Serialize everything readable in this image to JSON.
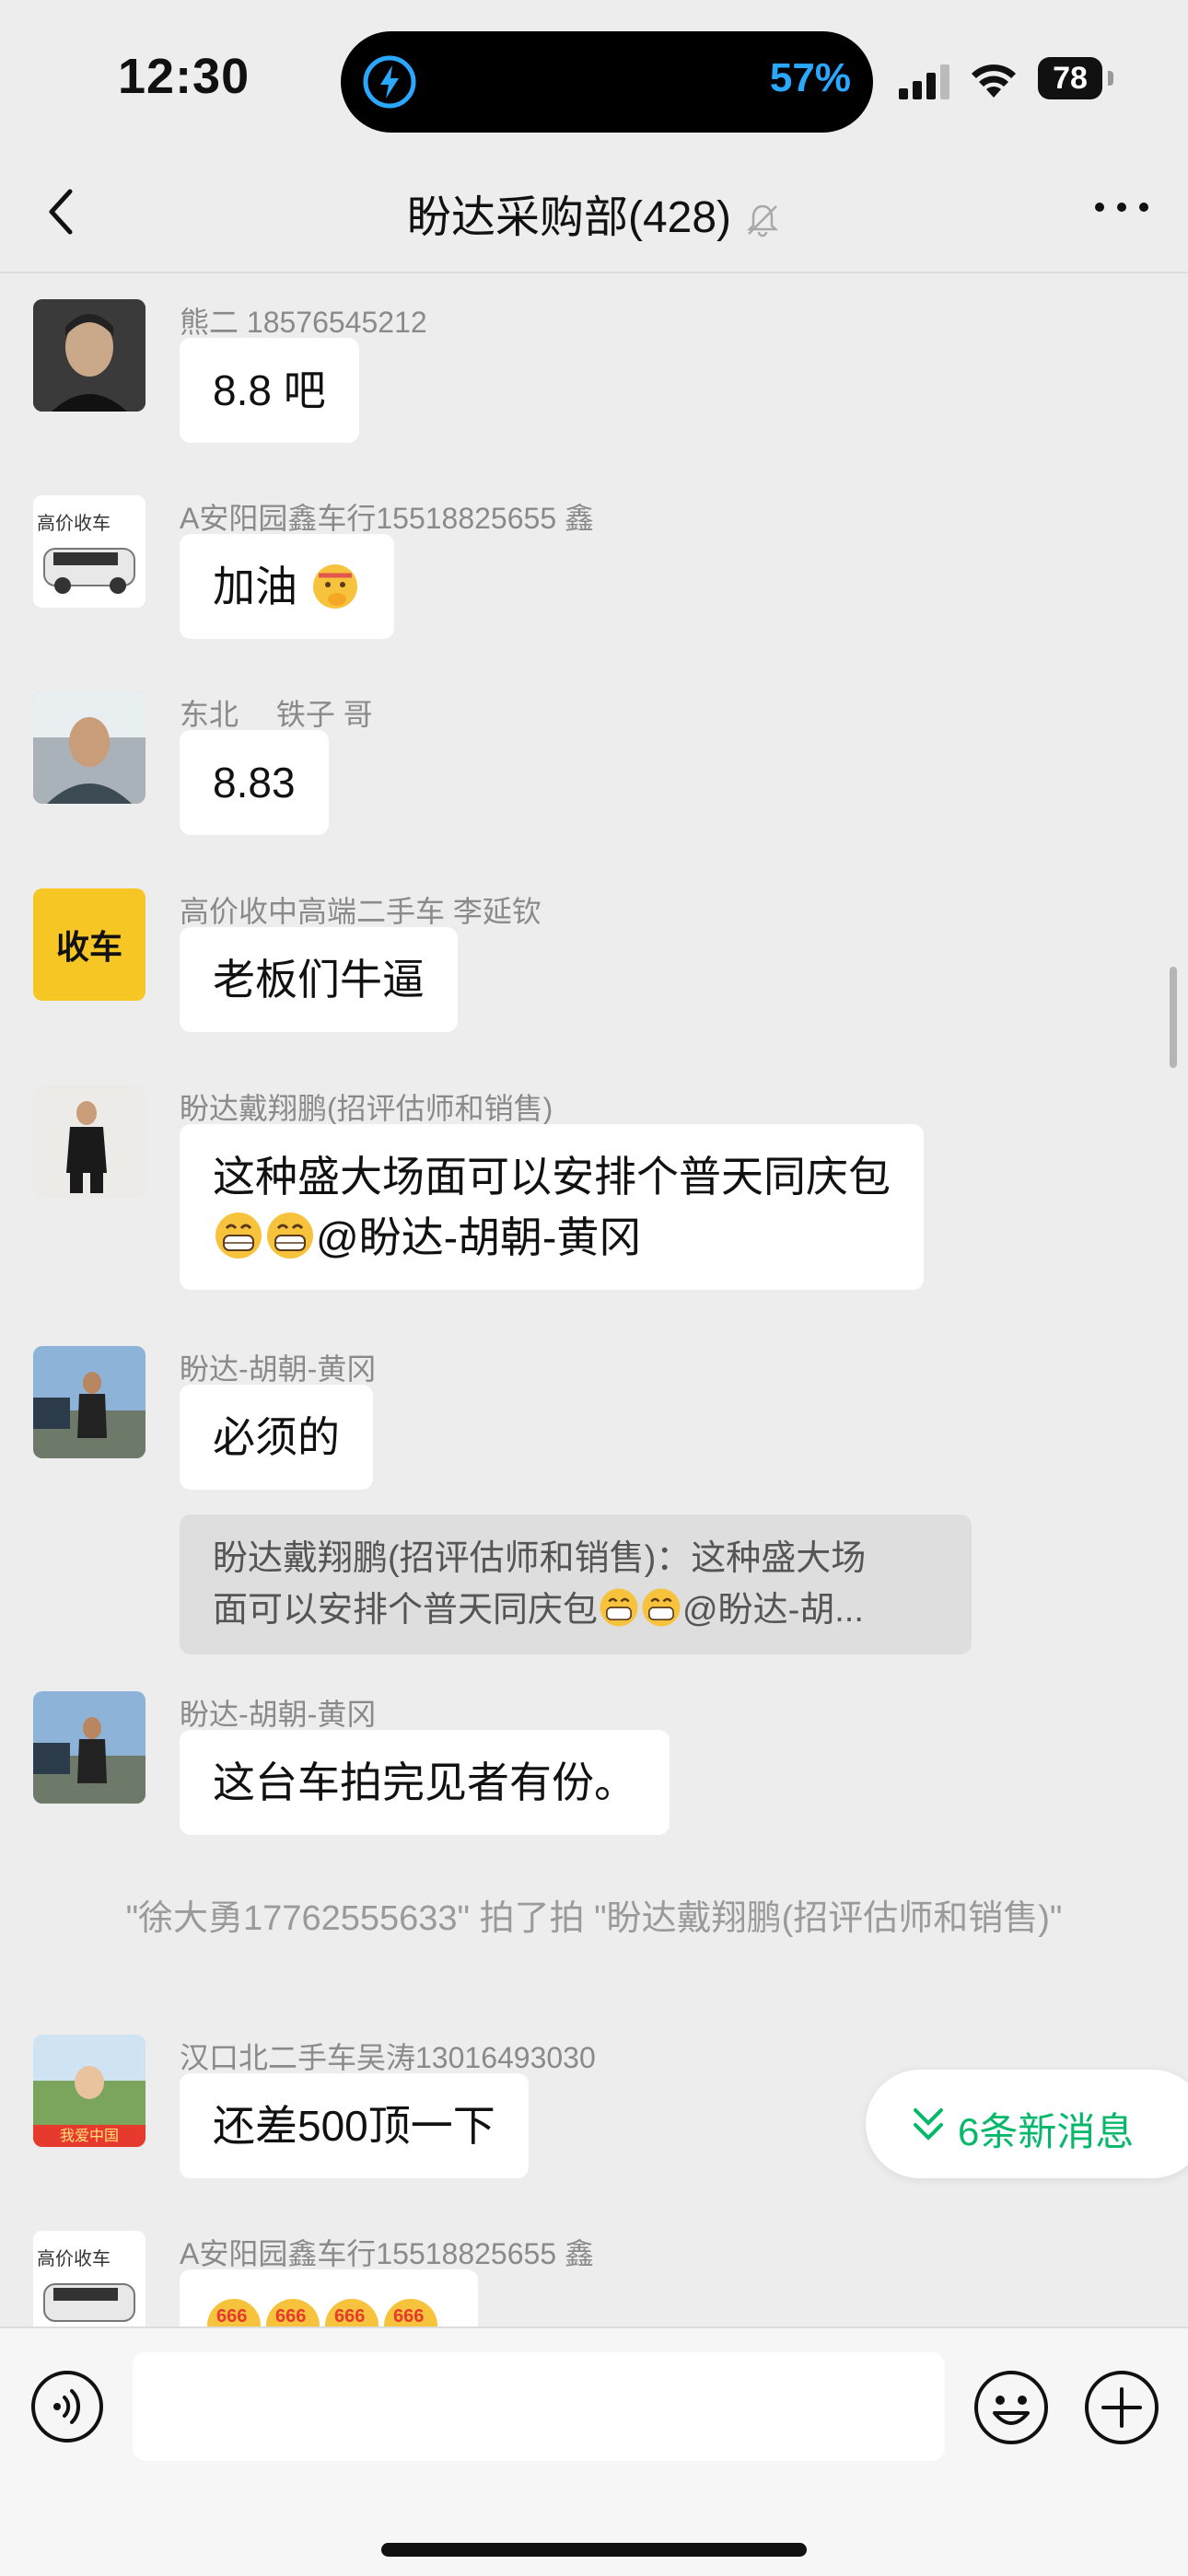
{
  "status": {
    "time": "12:30",
    "battery_percent": "57%",
    "battery_level": "78"
  },
  "header": {
    "title": "盼达采购部(428)"
  },
  "messages": [
    {
      "sender": "熊二 18576545212",
      "text": "8.8 吧"
    },
    {
      "sender": "A安阳园鑫车行15518825655 鑫",
      "text": "加油"
    },
    {
      "sender": "东北　 铁子 哥",
      "text": "8.83"
    },
    {
      "sender": "高价收中高端二手车 李延钦",
      "text": "老板们牛逼",
      "avatar_text": "收车"
    },
    {
      "sender": "盼达戴翔鹏(招评估师和销售)",
      "line1": "这种盛大场面可以安排个普天同庆包",
      "line2": "@盼达-胡朝-黄冈"
    },
    {
      "sender": "盼达-胡朝-黄冈",
      "text": "必须的",
      "quote_line1": "盼达戴翔鹏(招评估师和销售)：这种盛大场",
      "quote_line2": "面可以安排个普天同庆包",
      "quote_tail": "@盼达-胡..."
    },
    {
      "sender": "盼达-胡朝-黄冈",
      "text": "这台车拍完见者有份。"
    },
    {
      "sender": "汉口北二手车吴涛13016493030",
      "text": "还差500顶一下",
      "avatar_text": "我爱中国"
    },
    {
      "sender": "A安阳园鑫车行15518825655 鑫",
      "sticker_text": "666"
    }
  ],
  "system_note": "\"徐大勇17762555633\" 拍了拍 \"盼达戴翔鹏(招评估师和销售)\"",
  "new_messages_label": "6条新消息",
  "avatar_car_caption": "高价收车",
  "colors": {
    "accent_green": "#07b86b",
    "island_blue": "#2aa7ff",
    "background": "#ededed"
  }
}
